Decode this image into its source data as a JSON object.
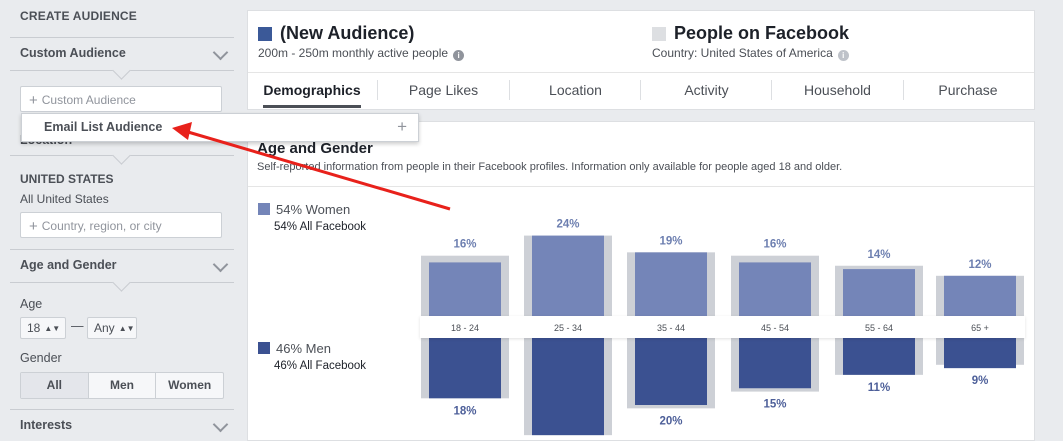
{
  "sidebar": {
    "header": "CREATE AUDIENCE",
    "custom_audience": {
      "title": "Custom Audience",
      "placeholder": "Custom Audience",
      "dropdown_item": "Email List Audience"
    },
    "location": {
      "title": "Location",
      "country": "UNITED STATES",
      "scope": "All United States",
      "placeholder": "Country, region, or city"
    },
    "age_gender": {
      "title": "Age and Gender",
      "age_label": "Age",
      "age_from": "18",
      "age_dash": "—",
      "age_to": "Any",
      "gender_label": "Gender",
      "gender_options": [
        "All",
        "Men",
        "Women"
      ],
      "gender_selected": "All"
    },
    "interests": {
      "title": "Interests"
    }
  },
  "header": {
    "audience_title": "(New Audience)",
    "audience_sub": "200m - 250m monthly active people",
    "compare_title": "People on Facebook",
    "compare_sub": "Country: United States of America",
    "colors": {
      "new_audience": "#3b5998",
      "facebook": "#dddfe2"
    }
  },
  "tabs": [
    "Demographics",
    "Page Likes",
    "Location",
    "Activity",
    "Household",
    "Purchase"
  ],
  "active_tab": "Demographics",
  "section": {
    "title": "Age and Gender",
    "subtitle": "Self-reported information from people in their Facebook profiles. Information only available for people aged 18 and older."
  },
  "legend": {
    "women": {
      "label": "54% Women",
      "sub": "54% All Facebook",
      "color": "#7485b8"
    },
    "men": {
      "label": "46% Men",
      "sub": "46% All Facebook",
      "color": "#3b5191"
    }
  },
  "chart_data": {
    "type": "bar",
    "categories": [
      "18 - 24",
      "25 - 34",
      "35 - 44",
      "45 - 54",
      "55 - 64",
      "65 +"
    ],
    "series": [
      {
        "name": "Women",
        "values": [
          16,
          24,
          19,
          16,
          14,
          12
        ],
        "labels": [
          "16%",
          "24%",
          "19%",
          "16%",
          "14%",
          "12%"
        ],
        "color": "#7485b8"
      },
      {
        "name": "Men",
        "values": [
          18,
          29,
          20,
          15,
          11,
          9
        ],
        "labels": [
          "18%",
          "",
          "20%",
          "15%",
          "11%",
          "9%"
        ],
        "color": "#3b5191"
      }
    ],
    "facebook_reference": {
      "women": [
        18,
        24,
        19,
        18,
        15,
        12
      ],
      "men": [
        18,
        29,
        21,
        16,
        11,
        8
      ],
      "color": "#cdd0d6"
    },
    "title": "Age and Gender"
  }
}
